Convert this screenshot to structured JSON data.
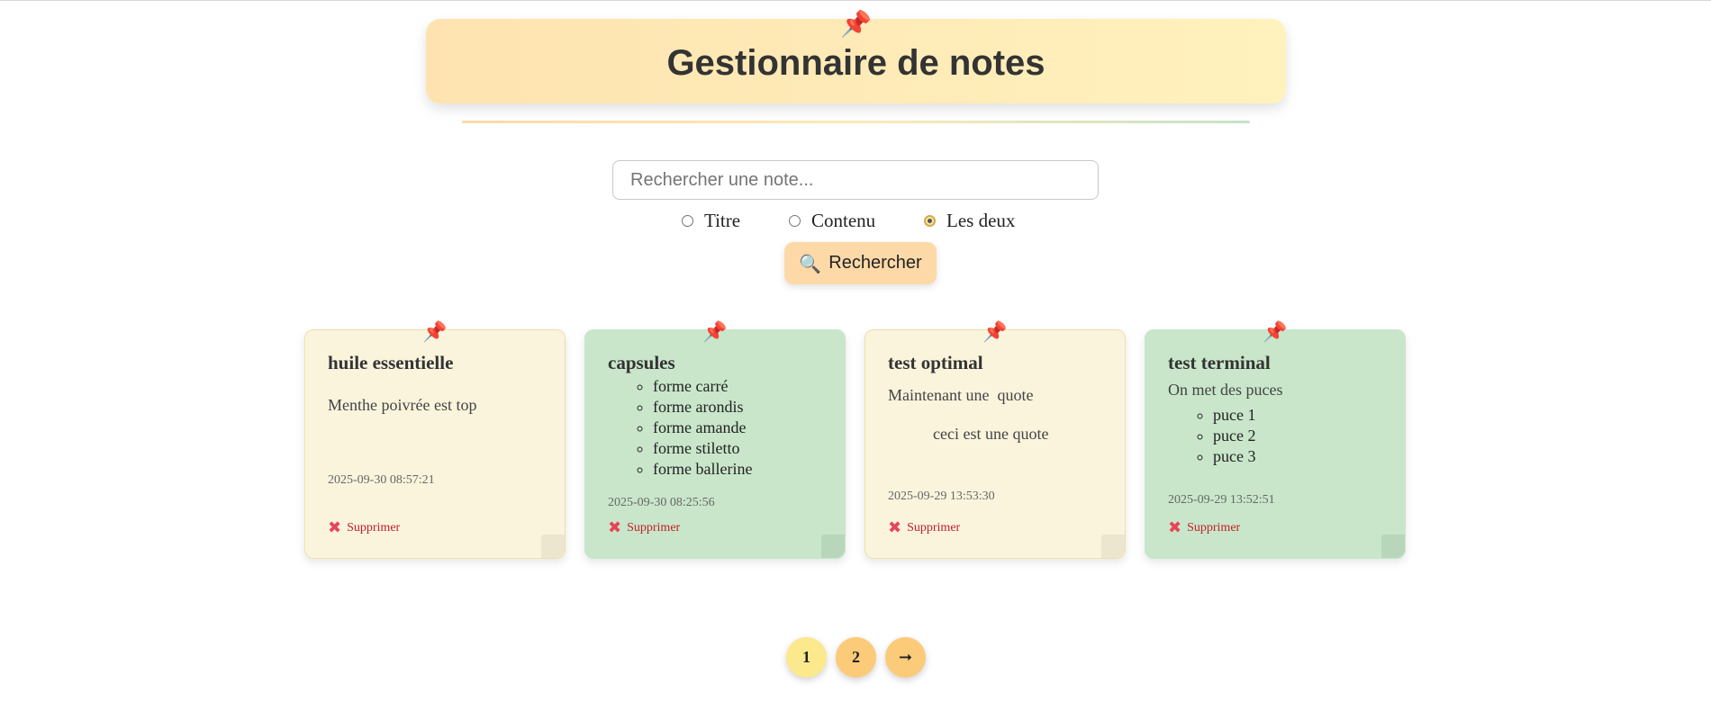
{
  "header": {
    "title": "Gestionnaire de notes",
    "pin_icon": "📌"
  },
  "search": {
    "placeholder": "Rechercher une note...",
    "value": "",
    "modes": [
      {
        "label": "Titre",
        "checked": false
      },
      {
        "label": "Contenu",
        "checked": false
      },
      {
        "label": "Les deux",
        "checked": true
      }
    ],
    "button_label": "Rechercher",
    "button_icon": "🔍"
  },
  "notes": [
    {
      "title": "huile essentielle",
      "content": "Menthe poivrée est top",
      "date": "2025-09-30 08:57:21",
      "color": "yellow",
      "delete_label": "Supprimer"
    },
    {
      "title": "capsules",
      "items": [
        "forme carré",
        "forme arondis",
        "forme amande",
        "forme stiletto",
        "forme ballerine"
      ],
      "date": "2025-09-30 08:25:56",
      "color": "green",
      "delete_label": "Supprimer"
    },
    {
      "title": "test optimal",
      "content": "Maintenant une  quote",
      "quote": "ceci est une quote",
      "date": "2025-09-29 13:53:30",
      "color": "yellow",
      "delete_label": "Supprimer"
    },
    {
      "title": "test terminal",
      "content": "On met des puces",
      "items": [
        "puce 1",
        "puce 2",
        "puce 3"
      ],
      "date": "2025-09-29 13:52:51",
      "color": "green",
      "delete_label": "Supprimer"
    }
  ],
  "pagination": {
    "pages": [
      "1",
      "2"
    ],
    "current": "1",
    "next_label": "➞"
  },
  "colors": {
    "note_yellow": "#faf4dd",
    "note_green": "#c9e6ca",
    "accent": "#fed9a8",
    "delete": "#c0202c"
  }
}
